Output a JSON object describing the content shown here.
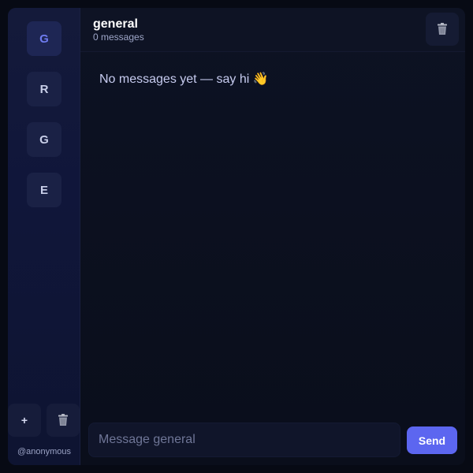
{
  "sidebar": {
    "rooms": [
      {
        "label": "G",
        "active": true
      },
      {
        "label": "R",
        "active": false
      },
      {
        "label": "G",
        "active": false
      },
      {
        "label": "E",
        "active": false
      }
    ],
    "add_label": "+",
    "delete_icon": "trash-icon",
    "username": "@anonymous"
  },
  "header": {
    "title": "general",
    "subtitle": "0 messages",
    "delete_icon": "trash-icon"
  },
  "messages": {
    "empty_text": "No messages yet — say hi 👋"
  },
  "composer": {
    "placeholder": "Message general",
    "value": "",
    "send_label": "Send"
  },
  "colors": {
    "accent": "#5c66f0",
    "sidebar_bg": "#131a3a",
    "main_bg": "#0b0f1d"
  }
}
